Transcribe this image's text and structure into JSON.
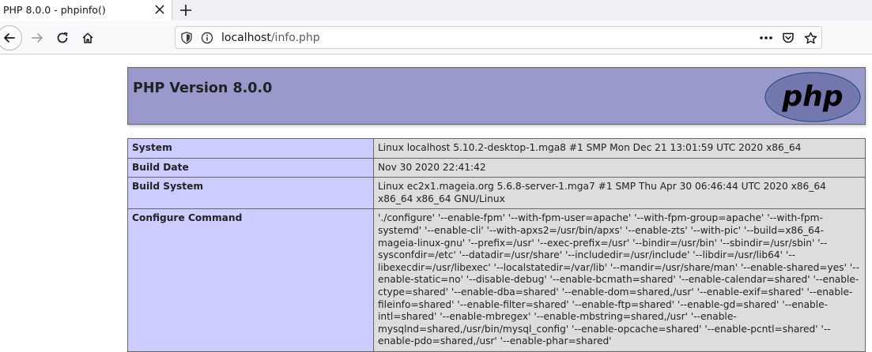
{
  "browser": {
    "tab_title": "PHP 8.0.0 - phpinfo()",
    "url_host": "localhost",
    "url_path": "/info.php"
  },
  "icons": {
    "tab_close": "close-icon",
    "new_tab": "plus-icon",
    "back": "arrow-left-icon",
    "forward": "arrow-right-icon",
    "reload": "reload-icon",
    "home": "home-icon",
    "tracking": "shield-icon",
    "site_info": "info-icon",
    "page_actions": "more-horizontal-icon",
    "pocket": "pocket-icon",
    "bookmark": "star-icon"
  },
  "page": {
    "title": "PHP Version 8.0.0",
    "logo_text": "php",
    "rows": [
      {
        "label": "System",
        "value": "Linux localhost 5.10.2-desktop-1.mga8 #1 SMP Mon Dec 21 13:01:59 UTC 2020 x86_64"
      },
      {
        "label": "Build Date",
        "value": "Nov 30 2020 22:41:42"
      },
      {
        "label": "Build System",
        "value": "Linux ec2x1.mageia.org 5.6.8-server-1.mga7 #1 SMP Thu Apr 30 06:46:44 UTC 2020 x86_64 x86_64 x86_64 GNU/Linux"
      },
      {
        "label": "Configure Command",
        "value": "'./configure' '--enable-fpm' '--with-fpm-user=apache' '--with-fpm-group=apache' '--with-fpm-systemd' '--enable-cli' '--with-apxs2=/usr/bin/apxs' '--enable-zts' '--with-pic' '--build=x86_64-mageia-linux-gnu' '--prefix=/usr' '--exec-prefix=/usr' '--bindir=/usr/bin' '--sbindir=/usr/sbin' '--sysconfdir=/etc' '--datadir=/usr/share' '--includedir=/usr/include' '--libdir=/usr/lib64' '--libexecdir=/usr/libexec' '--localstatedir=/var/lib' '--mandir=/usr/share/man' '--enable-shared=yes' '--enable-static=no' '--disable-debug' '--enable-bcmath=shared' '--enable-calendar=shared' '--enable-ctype=shared' '--enable-dba=shared' '--enable-dom=shared,/usr' '--enable-exif=shared' '--enable-fileinfo=shared' '--enable-filter=shared' '--enable-ftp=shared' '--enable-gd=shared' '--enable-intl=shared' '--enable-mbregex' '--enable-mbstring=shared,/usr' '--enable-mysqlnd=shared,/usr/bin/mysql_config' '--enable-opcache=shared' '--enable-pcntl=shared' '--enable-pdo=shared,/usr' '--enable-phar=shared'"
      }
    ]
  }
}
